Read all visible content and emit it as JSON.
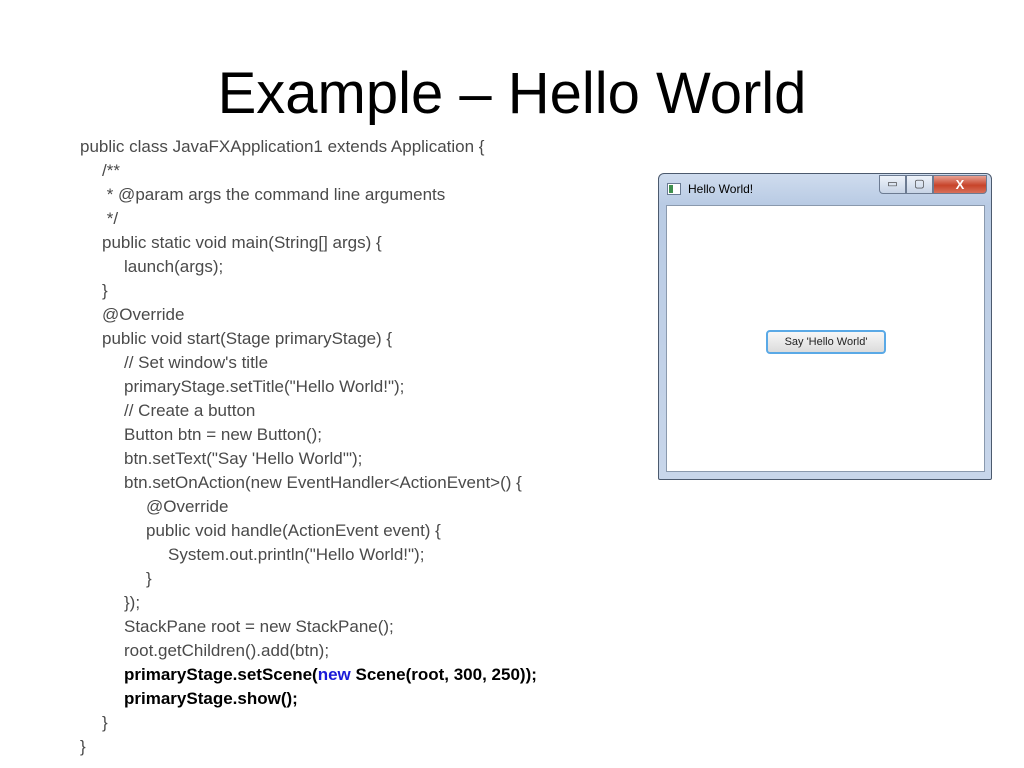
{
  "slide": {
    "title": "Example – Hello World"
  },
  "code_lines": [
    {
      "text": "public class JavaFXApplication1 extends Application {",
      "indent": 0
    },
    {
      "text": "/**",
      "indent": 1
    },
    {
      "text": " * @param args the command line arguments",
      "indent": 1
    },
    {
      "text": " */",
      "indent": 1
    },
    {
      "text": "public static void main(String[] args) {",
      "indent": 1
    },
    {
      "text": "launch(args);",
      "indent": 2
    },
    {
      "text": "}",
      "indent": 1
    },
    {
      "text": "@Override",
      "indent": 1
    },
    {
      "text": "public void start(Stage primaryStage) {",
      "indent": 1
    },
    {
      "text": "// Set window's title",
      "indent": 2
    },
    {
      "text": "primaryStage.setTitle(\"Hello World!\");",
      "indent": 2
    },
    {
      "text": "// Create a button",
      "indent": 2
    },
    {
      "text": "Button btn = new Button();",
      "indent": 2
    },
    {
      "text": "btn.setText(\"Say 'Hello World'\");",
      "indent": 2
    },
    {
      "text": "btn.setOnAction(new EventHandler<ActionEvent>() {",
      "indent": 2
    },
    {
      "text": "@Override",
      "indent": 3
    },
    {
      "text": "public void handle(ActionEvent event) {",
      "indent": 3
    },
    {
      "text": "System.out.println(\"Hello World!\");",
      "indent": 4
    },
    {
      "text": "}",
      "indent": 3
    },
    {
      "text": "});",
      "indent": 2
    },
    {
      "text": "StackPane root = new StackPane();",
      "indent": 2
    },
    {
      "text": "root.getChildren().add(btn);",
      "indent": 2
    },
    {
      "text": "primaryStage.setScene(",
      "kw": "new",
      "rest": " Scene(root, 300, 250));",
      "indent": 2,
      "bold": true
    },
    {
      "text": "primaryStage.show();",
      "indent": 2,
      "bold": true
    },
    {
      "text": "}",
      "indent": 1
    },
    {
      "text": "}",
      "indent": 0
    }
  ],
  "window": {
    "title": "Hello World!",
    "minimize_glyph": "▭",
    "maximize_glyph": "▢",
    "close_glyph": "X",
    "button_label": "Say 'Hello World'"
  },
  "colors": {
    "keyword": "#1a1ad8",
    "code_text": "#4a4a4a",
    "button_focus": "#5aa9e6"
  }
}
